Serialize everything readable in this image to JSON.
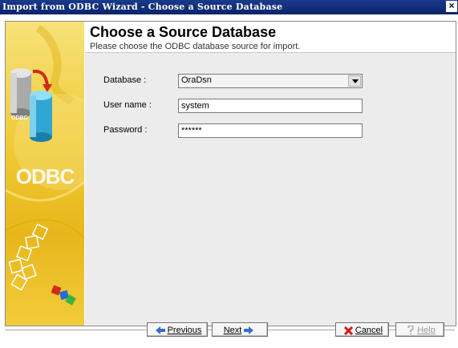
{
  "window": {
    "title": "Import from ODBC Wizard - Choose a Source Database",
    "close_glyph": "×"
  },
  "sidebar": {
    "logo_text": "ODBC",
    "small_text": "ODBC"
  },
  "header": {
    "title": "Choose a Source Database",
    "subtitle": "Please choose the ODBC database source for import."
  },
  "form": {
    "database_label": "Database :",
    "database_value": "OraDsn",
    "username_label": "User name :",
    "username_value": "system",
    "password_label": "Password :",
    "password_value": "******"
  },
  "buttons": {
    "previous": "Previous",
    "next": "Next",
    "cancel": "Cancel",
    "help": "Help"
  },
  "icons": {
    "previous": "arrow-left-icon",
    "next": "arrow-right-icon",
    "cancel": "red-x-icon",
    "help": "question-mark-icon"
  },
  "colors": {
    "titlebar": "#0a246a",
    "sidebar": "#f0cb36",
    "body": "#ececec",
    "arrow_blue": "#3a6cc8",
    "cancel_red": "#d81818"
  }
}
